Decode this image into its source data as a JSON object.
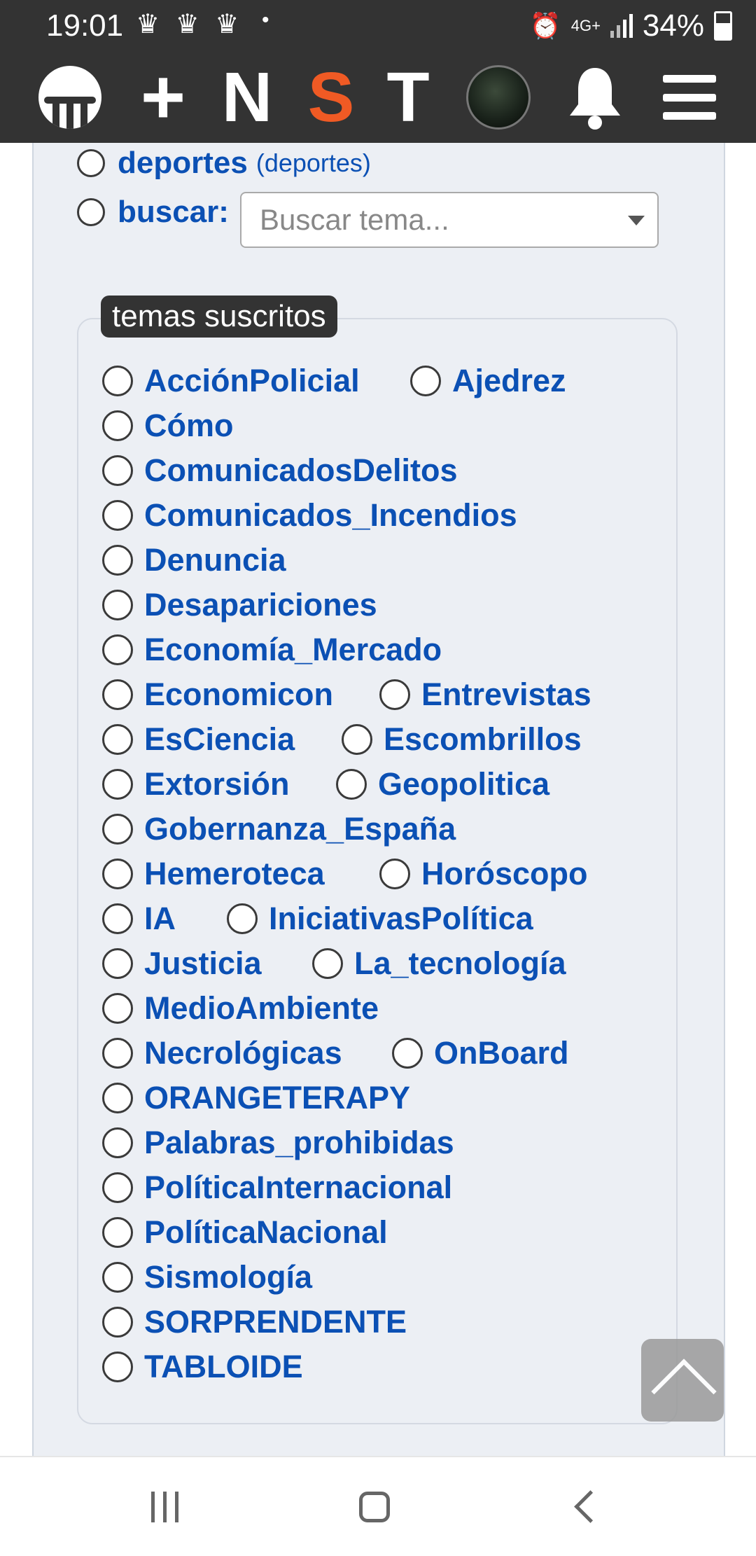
{
  "status_bar": {
    "time": "19:01",
    "crowns": "♛ ♛ ♛",
    "dot": "•",
    "network": "4G+",
    "battery": "34%"
  },
  "nav": {
    "items": [
      "+",
      "N",
      "S",
      "T"
    ],
    "accent_color": "#f05a24"
  },
  "filters": {
    "deportes_label": "deportes",
    "deportes_sub": "(deportes)",
    "buscar_label": "buscar:",
    "buscar_placeholder": "Buscar tema..."
  },
  "subscribed": {
    "legend": "temas suscritos",
    "topics": [
      "AcciónPolicial",
      "Ajedrez",
      "Cómo",
      "ComunicadosDelitos",
      "Comunicados_Incendios",
      "Denuncia",
      "Desapariciones",
      "Economía_Mercado",
      "Economicon",
      "Entrevistas",
      "EsCiencia",
      "Escombrillos",
      "Extorsión",
      "Geopolitica",
      "Gobernanza_España",
      "Hemeroteca",
      "Horóscopo",
      "IA",
      "IniciativasPolítica",
      "Justicia",
      "La_tecnología",
      "MedioAmbiente",
      "Necrológicas",
      "OnBoard",
      "ORANGETERAPY",
      "Palabras_prohibidas",
      "PolíticaInternacional",
      "PolíticaNacional",
      "Sismología",
      "SORPRENDENTE",
      "TABLOIDE"
    ]
  }
}
